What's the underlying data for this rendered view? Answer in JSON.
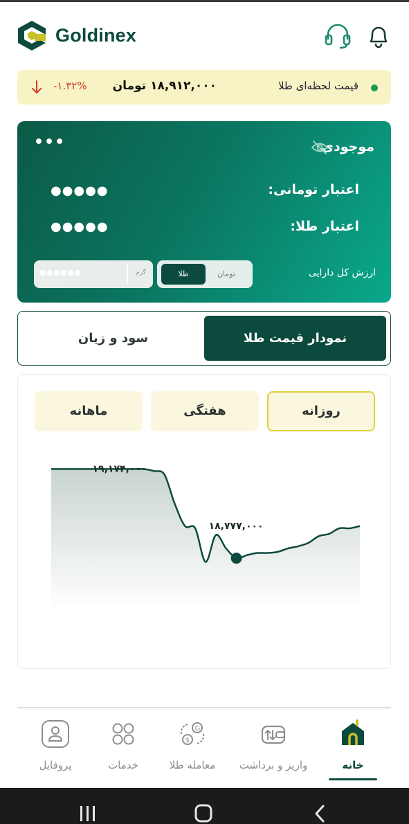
{
  "app": {
    "brand": "Goldinex"
  },
  "header": {
    "support_icon": "headset-icon",
    "notifications_icon": "bell-icon"
  },
  "live_price": {
    "label": "قیمت لحظه‌ای طلا",
    "price": "۱۸,۹۱۲,۰۰۰ تومان",
    "change": "-۱.۳۲%",
    "status_color": "#1c9a50",
    "change_color": "#d23a2a"
  },
  "balance": {
    "title": "موجودی",
    "more": "•••",
    "toman_credit_label": "اعتبار تومانی:",
    "toman_credit_value": "●●●●●",
    "gold_credit_label": "اعتبار طلا:",
    "gold_credit_value": "●●●●●",
    "total_assets_label": "ارزش کل دارایی",
    "unit_toggle": {
      "active": "طلا",
      "inactive": "تومان"
    },
    "amount_mask": "●●●●●●",
    "amount_unit": "گرم"
  },
  "main_tabs": {
    "active": "نمودار قیمت طلا",
    "inactive": "سود و زیان"
  },
  "periods": {
    "daily": "روزانه",
    "weekly": "هفتگی",
    "monthly": "ماهانه",
    "selected": "daily"
  },
  "chart_data": {
    "type": "area",
    "title": "",
    "xlabel": "",
    "ylabel": "",
    "grid": false,
    "series": [
      {
        "values": [
          19174000,
          19174000,
          19174000,
          19174000,
          19174000,
          19174000,
          19174000,
          19174000,
          19174000,
          19174000,
          19165000,
          19150000,
          19020000,
          18920000,
          18910000,
          18760000,
          18880000,
          18820000,
          18777000,
          18790000,
          18800000,
          18800000,
          18805000,
          18820000,
          18830000,
          18845000,
          18875000,
          18885000,
          18910000,
          18910000,
          18920000
        ]
      }
    ],
    "max_label": "۱۹,۱۷۴,۰۰۰",
    "max_value": 19174000,
    "min_label": "۱۸,۷۷۷,۰۰۰",
    "min_value": 18777000,
    "ylim": [
      18700000,
      19200000
    ],
    "line_color": "#0d4a3e"
  },
  "nav": {
    "items": [
      {
        "key": "home",
        "label": "خانه",
        "icon": "home-icon",
        "active": true
      },
      {
        "key": "deposit",
        "label": "واریز و برداشت",
        "icon": "wallet-transfer-icon",
        "active": false
      },
      {
        "key": "trade",
        "label": "معامله طلا",
        "icon": "exchange-coins-icon",
        "active": false
      },
      {
        "key": "services",
        "label": "خدمات",
        "icon": "grid-icon",
        "active": false
      },
      {
        "key": "profile",
        "label": "پروفایل",
        "icon": "user-icon",
        "active": false
      }
    ]
  },
  "system_bar": {
    "recents_icon": "recents-icon",
    "home_icon": "home-circle-icon",
    "back_icon": "back-icon"
  }
}
